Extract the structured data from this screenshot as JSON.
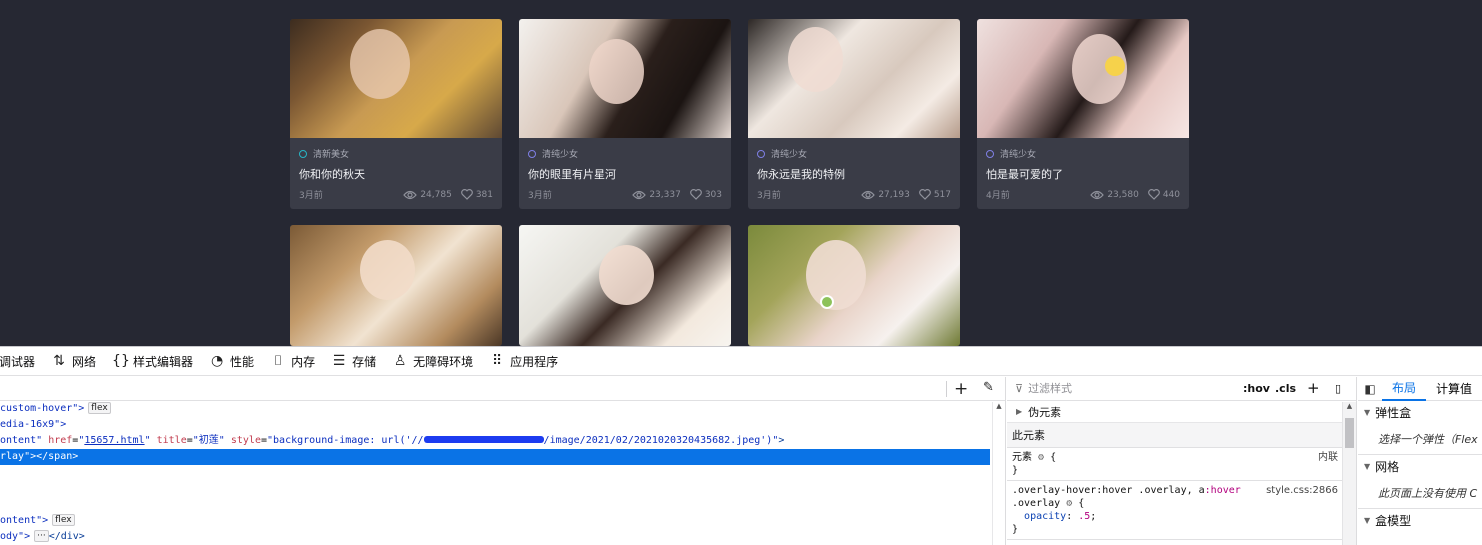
{
  "cards": [
    {
      "category": "清新美女",
      "title": "你和你的秋天",
      "time": "3月前",
      "views": "24,785",
      "likes": "381",
      "dot_color": "#27b6c6"
    },
    {
      "category": "清纯少女",
      "title": "你的眼里有片星河",
      "time": "3月前",
      "views": "23,337",
      "likes": "303",
      "dot_color": "#7f80e6"
    },
    {
      "category": "清纯少女",
      "title": "你永远是我的特例",
      "time": "3月前",
      "views": "27,193",
      "likes": "517",
      "dot_color": "#7f80e6"
    },
    {
      "category": "清纯少女",
      "title": "怕是最可爱的了",
      "time": "4月前",
      "views": "23,580",
      "likes": "440",
      "dot_color": "#7f80e6"
    }
  ],
  "devtools": {
    "tabs": [
      {
        "icon": "debugger-icon",
        "label": "调试器"
      },
      {
        "icon": "network-icon",
        "label": "网络"
      },
      {
        "icon": "style-editor-icon",
        "label": "样式编辑器"
      },
      {
        "icon": "performance-icon",
        "label": "性能"
      },
      {
        "icon": "memory-icon",
        "label": "内存"
      },
      {
        "icon": "storage-icon",
        "label": "存储"
      },
      {
        "icon": "accessibility-icon",
        "label": "无障碍环境"
      },
      {
        "icon": "application-icon",
        "label": "应用程序"
      }
    ],
    "markup": {
      "line1_cls": "custom-hover\">",
      "line1_badge": "flex",
      "line2": "edia-16x9\">",
      "line3_pre": "ontent\"",
      "line3_href_attr": "href",
      "line3_href": "15657.html",
      "line3_title_attr": "title",
      "line3_title": "初莲",
      "line3_style_attr": "style",
      "line3_style_pre": "background-image: url('//",
      "line3_style_post": "/image/2021/02/2021020320435682.jpeg')",
      "line4": "rlay\"></span>",
      "line7": "ontent\">",
      "line7_badge": "flex",
      "line8": "ody\">",
      "line8_badge": "···",
      "line8_close": "</div>"
    },
    "rules": {
      "filter_placeholder": "过滤样式",
      "hov": ":hov",
      "cls": ".cls",
      "pseudo": "伪元素",
      "this_element": "此元素",
      "element_selector": "元素",
      "inline": "内联",
      "selector": ".overlay-hover:hover .overlay, a",
      "selector_hover": ":hover",
      "source": "style.css:2866",
      "selector2": ".overlay",
      "prop": "opacity",
      "value": ".5"
    },
    "layout": {
      "tab_layout": "布局",
      "tab_computed": "计算值",
      "flex_title": "弹性盒",
      "flex_note": "选择一个弹性（Flex",
      "grid_title": "网格",
      "grid_note": "此页面上没有使用 C",
      "box_title": "盒模型"
    }
  }
}
